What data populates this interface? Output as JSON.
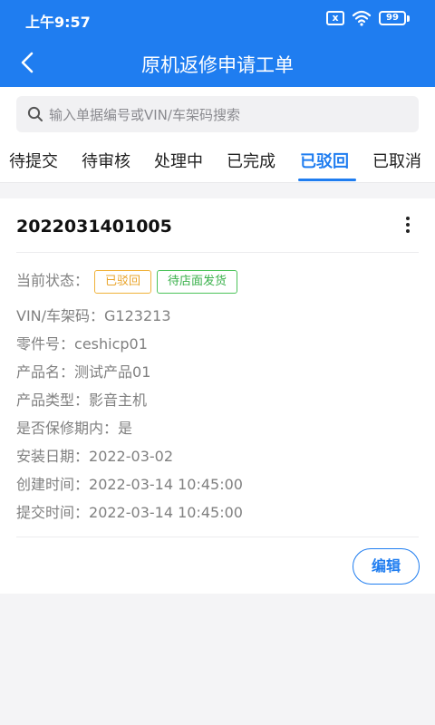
{
  "status_bar": {
    "time": "上午9:57",
    "battery": "99",
    "sim_icon_text": "x"
  },
  "header": {
    "title": "原机返修申请工单"
  },
  "search": {
    "placeholder": "输入单据编号或VIN/车架码搜索"
  },
  "tabs": [
    {
      "label": "待提交",
      "active": false
    },
    {
      "label": "待审核",
      "active": false
    },
    {
      "label": "处理中",
      "active": false
    },
    {
      "label": "已完成",
      "active": false
    },
    {
      "label": "已驳回",
      "active": true
    },
    {
      "label": "已取消",
      "active": false
    }
  ],
  "order": {
    "number": "2022031401005",
    "status_label": "当前状态：",
    "status_badges": [
      "已驳回",
      "待店面发货"
    ],
    "fields": [
      {
        "label": "VIN/车架码：",
        "value": "G123213"
      },
      {
        "label": "零件号：",
        "value": "ceshicp01"
      },
      {
        "label": "产品名：",
        "value": "测试产品01"
      },
      {
        "label": "产品类型：",
        "value": "影音主机"
      },
      {
        "label": "是否保修期内：",
        "value": "是"
      },
      {
        "label": "安装日期：",
        "value": "2022-03-02"
      },
      {
        "label": "创建时间：",
        "value": "2022-03-14 10:45:00"
      },
      {
        "label": "提交时间：",
        "value": "2022-03-14 10:45:00"
      }
    ],
    "edit_label": "编辑"
  },
  "colors": {
    "primary": "#1f7df0",
    "badge_rejected": "#e9a42a",
    "badge_ship": "#39b04a",
    "background": "#f4f4f6"
  }
}
